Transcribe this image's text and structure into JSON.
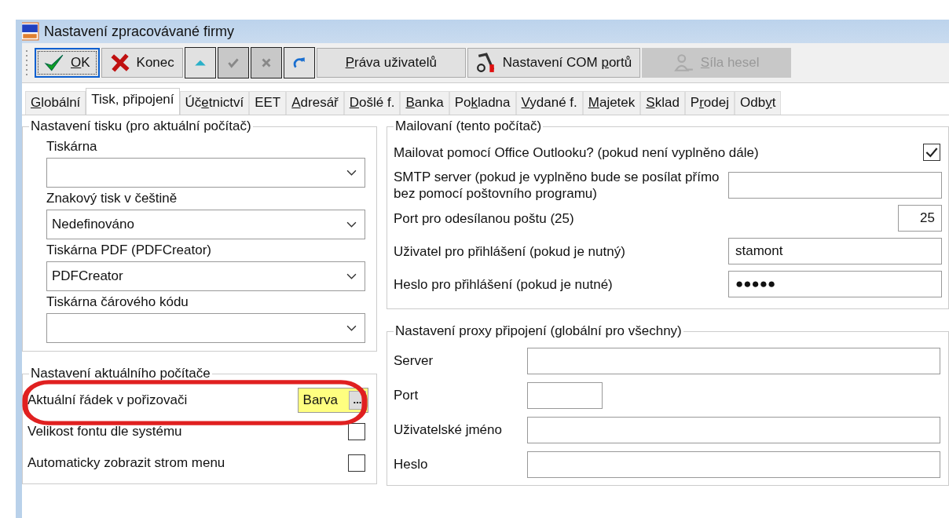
{
  "window": {
    "title": "Nastavení zpracovávané firmy"
  },
  "toolbar": [
    {
      "kind": "text",
      "key": "O",
      "post": "K",
      "focused": true,
      "disabled": false
    },
    {
      "kind": "text",
      "post": "Konec",
      "focused": false,
      "disabled": false
    },
    {
      "kind": "icon",
      "disabled": false
    },
    {
      "kind": "icon",
      "disabled": true
    },
    {
      "kind": "icon",
      "disabled": true
    },
    {
      "kind": "icon",
      "disabled": false
    },
    {
      "kind": "text",
      "key": "P",
      "post": "ráva uživatelů",
      "focused": false,
      "disabled": false
    },
    {
      "kind": "text",
      "pre": "Nastavení COM ",
      "key": "p",
      "post": "ortů",
      "focused": false,
      "disabled": false
    },
    {
      "kind": "text",
      "key": "S",
      "post": "íla hesel",
      "focused": false,
      "disabled": true
    }
  ],
  "tabs": [
    {
      "key": "G",
      "post": "lobální",
      "selected": false
    },
    {
      "pre": "Tisk, připojení",
      "selected": true
    },
    {
      "pre": "Úč",
      "key": "e",
      "post": "tnictví",
      "selected": false
    },
    {
      "pre": "EET",
      "selected": false
    },
    {
      "key": "A",
      "post": "dresář",
      "selected": false
    },
    {
      "key": "D",
      "post": "ošlé f.",
      "selected": false
    },
    {
      "key": "B",
      "post": "anka",
      "selected": false
    },
    {
      "pre": "Po",
      "key": "k",
      "post": "ladna",
      "selected": false
    },
    {
      "key": "V",
      "post": "ydané f.",
      "selected": false
    },
    {
      "key": "M",
      "post": "ajetek",
      "selected": false
    },
    {
      "key": "S",
      "post": "klad",
      "selected": false
    },
    {
      "pre": "P",
      "key": "r",
      "post": "odej",
      "selected": false
    },
    {
      "pre": "Odb",
      "key": "y",
      "post": "t",
      "selected": false
    }
  ],
  "print_group": {
    "title": "Nastavení tisku (pro aktuální počítač)",
    "fields": [
      {
        "label": "Tiskárna"
      },
      {
        "label": "Znakový tisk v češtině",
        "value": "Nedefinováno"
      },
      {
        "label": "Tiskárna PDF (PDFCreator)",
        "value": "PDFCreator"
      },
      {
        "label": "Tiskárna čárového kódu"
      }
    ]
  },
  "computer_group": {
    "title": "Nastavení aktuálního počítače",
    "rows": [
      {
        "kind": "color",
        "label": "Aktuální řádek v pořizovači",
        "value": "Barva",
        "button": "...",
        "color": "#ffff80"
      },
      {
        "kind": "checkbox",
        "label": "Velikost fontu dle systému",
        "checked": false
      },
      {
        "kind": "checkbox",
        "label": "Automaticky zobrazit strom menu",
        "checked": false
      }
    ]
  },
  "mail_group": {
    "title": "Mailovaní (tento počítač)",
    "rows": [
      {
        "kind": "checkbox",
        "label": "Mailovat pomocí Office Outlooku? (pokud není vyplněno dále)",
        "checked": true
      },
      {
        "kind": "text",
        "label": "SMTP server (pokud je vyplněno bude se posílat přímo bez pomocí poštovního programu)"
      },
      {
        "kind": "number",
        "label": "Port pro odesílanou poštu (25)",
        "value": "25"
      },
      {
        "kind": "text",
        "label": "Uživatel pro přihlášení (pokud je nutný)",
        "value": "stamont"
      },
      {
        "kind": "text",
        "label": "Heslo pro přihlášení (pokud je nutné)",
        "value": "●●●●●"
      }
    ]
  },
  "proxy_group": {
    "title": "Nastavení proxy připojení (globální pro všechny)",
    "rows": [
      {
        "kind": "text",
        "label": "Server"
      },
      {
        "kind": "short",
        "label": "Port"
      },
      {
        "kind": "text",
        "label": "Uživatelské jméno"
      },
      {
        "kind": "text",
        "label": "Heslo"
      }
    ]
  },
  "annotation": {
    "kind": "ellipse"
  }
}
